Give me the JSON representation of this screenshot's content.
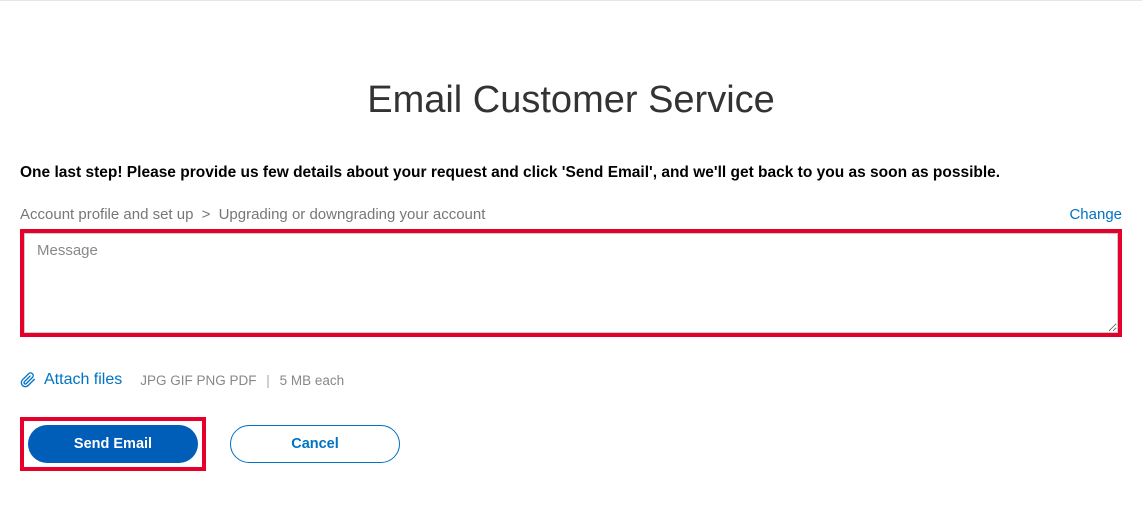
{
  "page": {
    "title": "Email Customer Service",
    "instruction": "One last step! Please provide us few details about your request and click 'Send Email', and we'll get back to you as soon as possible."
  },
  "breadcrumb": {
    "level1": "Account profile and set up",
    "separator": ">",
    "level2": "Upgrading or downgrading your account",
    "change_label": "Change"
  },
  "message": {
    "placeholder": "Message",
    "value": ""
  },
  "attach": {
    "label": "Attach files",
    "formats": "JPG GIF PNG PDF",
    "divider": "|",
    "size_hint": "5 MB each"
  },
  "buttons": {
    "send": "Send Email",
    "cancel": "Cancel"
  }
}
